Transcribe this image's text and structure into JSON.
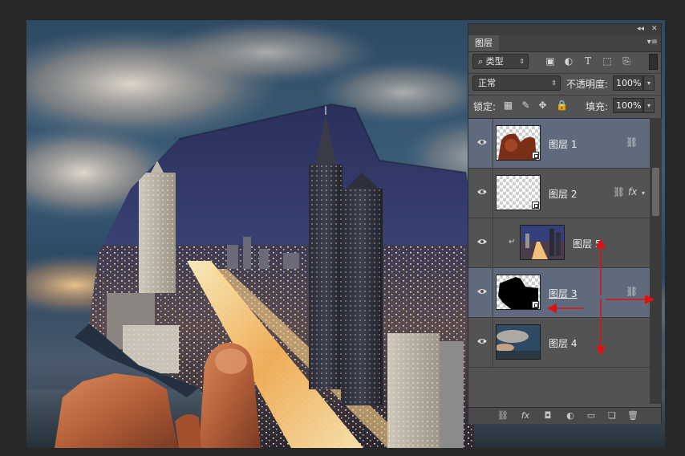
{
  "panel": {
    "collapse_glyph": "◂◂",
    "close_glyph": "✕",
    "tab_label": "图层",
    "tab_menu_glyph": "▾≡",
    "filter": {
      "search_glyph": "⌕",
      "value": "类型",
      "arrow": "⇕"
    },
    "filter_icons": [
      "image-filter-icon",
      "adjustment-filter-icon",
      "type-filter-icon",
      "shape-filter-icon",
      "smart-object-filter-icon"
    ],
    "blend_mode": {
      "value": "正常",
      "arrow": "⇕"
    },
    "opacity": {
      "label": "不透明度:",
      "value": "100%",
      "arrow": "▾"
    },
    "lock": {
      "label": "锁定:"
    },
    "fill": {
      "label": "填充:",
      "value": "100%",
      "arrow": "▾"
    },
    "layers": [
      {
        "name": "图层 1",
        "selected": true,
        "thumb": "hand-photo",
        "smart": true,
        "linked": true,
        "fx": false,
        "clipped": false
      },
      {
        "name": "图层 2",
        "selected": false,
        "thumb": "transparent",
        "smart": true,
        "linked": true,
        "fx": true,
        "clipped": false
      },
      {
        "name": "图层 5",
        "selected": false,
        "thumb": "city-photo",
        "smart": false,
        "linked": false,
        "fx": false,
        "clipped": true
      },
      {
        "name": "图层 3",
        "selected": true,
        "thumb": "black-mask",
        "smart": true,
        "linked": true,
        "fx": false,
        "clipped": false
      },
      {
        "name": "图层 4",
        "selected": false,
        "thumb": "sky-photo",
        "smart": false,
        "linked": false,
        "fx": false,
        "clipped": false
      }
    ],
    "bottom_icons": [
      "link-layers-icon",
      "fx-icon",
      "add-mask-icon",
      "adjustment-layer-icon",
      "new-group-icon",
      "new-layer-icon",
      "trash-icon"
    ],
    "bottom_glyphs": [
      "⛓",
      "fx",
      "◘",
      "◐",
      "▭",
      "❏",
      "🗑"
    ]
  },
  "colors": {
    "panel_bg": "#535353",
    "selected_row": "#5f6b7d",
    "annotation_red": "#e01010"
  }
}
